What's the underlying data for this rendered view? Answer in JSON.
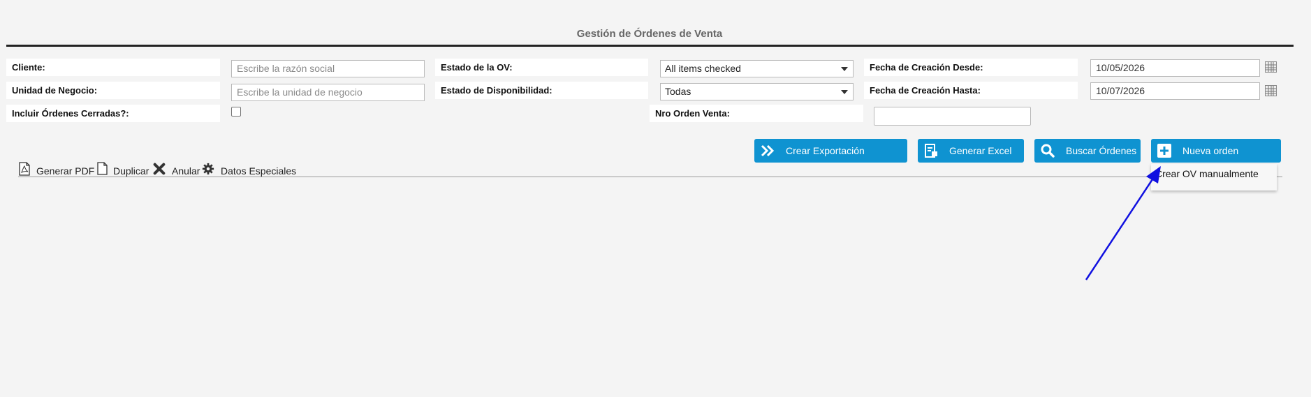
{
  "page": {
    "title": "Gestión de Órdenes de Venta"
  },
  "filters": {
    "cliente": {
      "label": "Cliente:",
      "placeholder": "Escribe la razón social"
    },
    "unidad": {
      "label": "Unidad de Negocio:",
      "placeholder": "Escribe la unidad de negocio"
    },
    "cerradas": {
      "label": "Incluir Órdenes Cerradas?:",
      "checked": false
    },
    "estado_ov": {
      "label": "Estado de la OV:",
      "value": "All items checked"
    },
    "estado_disp": {
      "label": "Estado de Disponibilidad:",
      "value": "Todas"
    },
    "nro_orden": {
      "label": "Nro Orden Venta:",
      "value": ""
    },
    "fecha_desde": {
      "label": "Fecha de Creación Desde:",
      "value": "10/05/2026"
    },
    "fecha_hasta": {
      "label": "Fecha de Creación Hasta:",
      "value": "10/07/2026"
    }
  },
  "buttons": {
    "crear_exportacion": {
      "label": "Crear Exportación",
      "icon": "double-chevron-right-icon"
    },
    "generar_excel": {
      "label": "Generar Excel",
      "icon": "excel-icon"
    },
    "buscar_ordenes": {
      "label": "Buscar Órdenes",
      "icon": "search-icon"
    },
    "nueva_orden": {
      "label": "Nueva orden",
      "icon": "plus-icon"
    }
  },
  "toolbar": {
    "pdf": {
      "label": "Generar PDF",
      "icon": "pdf-icon"
    },
    "duplicar": {
      "label": "Duplicar",
      "icon": "document-icon"
    },
    "anular": {
      "label": "Anular",
      "icon": "x-icon"
    },
    "datos": {
      "label": "Datos Especiales",
      "icon": "gear-icon"
    }
  },
  "dropdown": {
    "items": [
      "Crear OV manualmente"
    ]
  },
  "colors": {
    "button": "#0f93d1",
    "arrow": "#1010e0"
  }
}
